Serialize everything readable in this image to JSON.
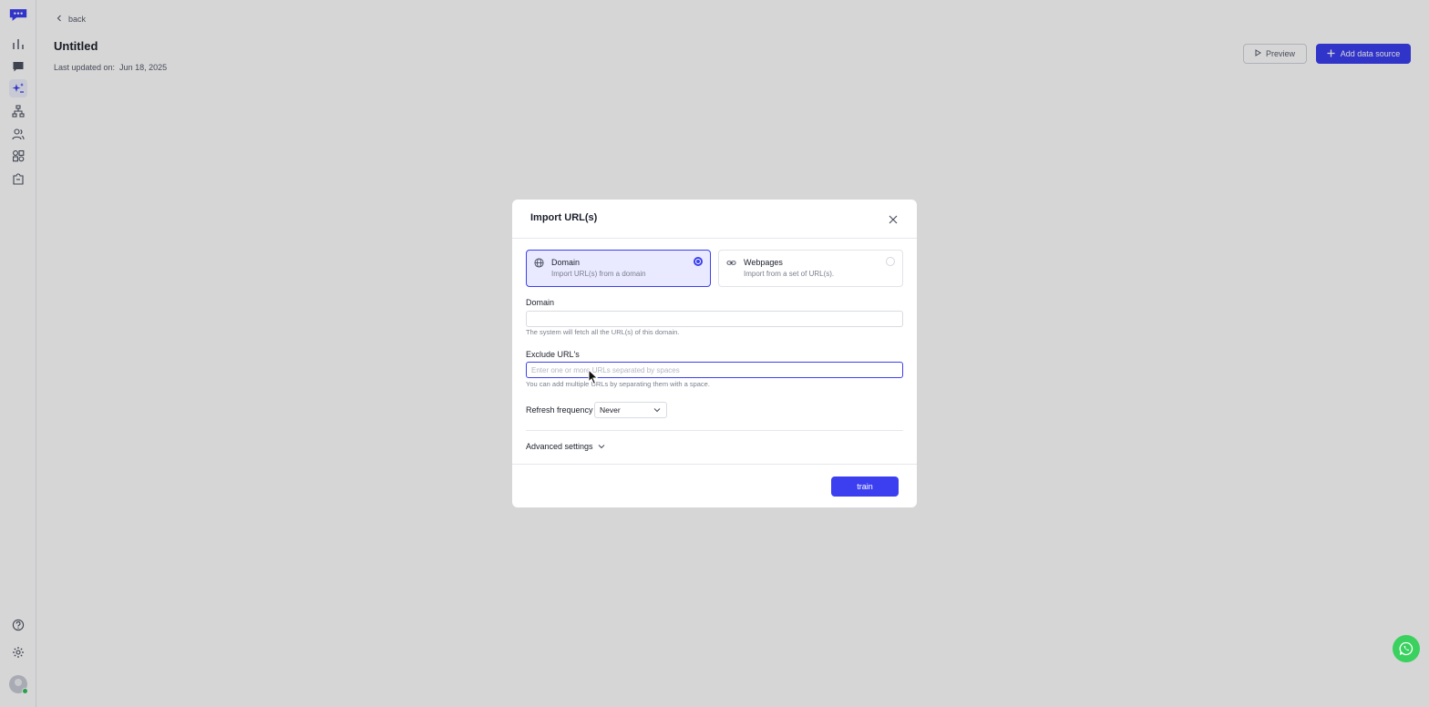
{
  "header": {
    "back_label": "back",
    "title": "Untitled",
    "last_updated": "Last updated on:  Jun 18, 2025",
    "preview_label": "Preview",
    "add_source_label": "Add data source"
  },
  "sidebar": {
    "items": [
      {
        "icon": "logo-icon"
      },
      {
        "icon": "bar-chart-icon"
      },
      {
        "icon": "chat-icon"
      },
      {
        "icon": "sparkles-icon",
        "active": true
      },
      {
        "icon": "sitemap-icon"
      },
      {
        "icon": "users-icon"
      },
      {
        "icon": "apps-icon"
      },
      {
        "icon": "integrations-icon"
      },
      {
        "icon": "help-icon"
      },
      {
        "icon": "gear-icon"
      }
    ]
  },
  "modal": {
    "title": "Import URL(s)",
    "options": [
      {
        "title": "Domain",
        "desc": "Import URL(s) from a domain",
        "selected": true
      },
      {
        "title": "Webpages",
        "desc": "Import from a set of URL(s).",
        "selected": false
      }
    ],
    "domain": {
      "label": "Domain",
      "value": "",
      "placeholder": "",
      "helper": "The system will fetch all the URL(s) of this domain."
    },
    "exclude": {
      "label": "Exclude URL's",
      "value": "",
      "placeholder": "Enter one or more URLs separated by spaces",
      "helper": "You can add multiple URLs by separating them with a space."
    },
    "refresh": {
      "label": "Refresh frequency",
      "value": "Never"
    },
    "advanced_label": "Advanced settings",
    "train_label": "train"
  },
  "colors": {
    "accent": "#3b3ff0",
    "selected_bg": "#e9eaff",
    "whatsapp": "#3ad15f"
  }
}
